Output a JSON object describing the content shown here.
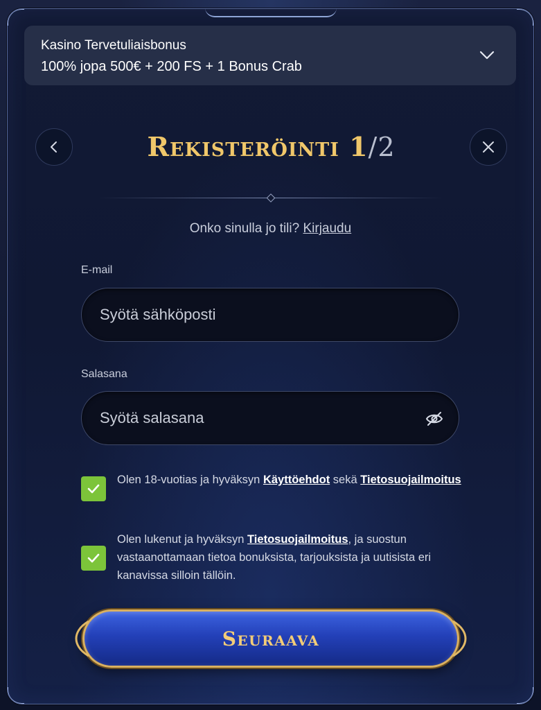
{
  "bonus": {
    "title": "Kasino Tervetuliaisbonus",
    "value": "100% jopa 500€ + 200 FS + 1 Bonus Crab"
  },
  "header": {
    "title": "Rekisteröinti 1",
    "step": "/2"
  },
  "login": {
    "prompt": "Onko sinulla jo tili?",
    "link": "Kirjaudu"
  },
  "form": {
    "email_label": "E-mail",
    "email_placeholder": "Syötä sähköposti",
    "password_label": "Salasana",
    "password_placeholder": "Syötä salasana"
  },
  "consents": [
    {
      "checked": true,
      "text_before": "Olen 18-vuotias ja hyväksyn",
      "link1": "Käyttöehdot",
      "text_middle": "sekä",
      "link2": "Tietosuojailmoitus"
    },
    {
      "checked": true,
      "text_before": "Olen lukenut ja hyväksyn",
      "link1": "Tietosuojailmoitus",
      "text_after": ", ja suostun vastaanottamaan tietoa bonuksista, tarjouksista ja uutisista eri kanavissa silloin tällöin."
    }
  ],
  "next_button": "Seuraava",
  "colors": {
    "gold": "#f0c76a",
    "check_green": "#7cc43a",
    "button_blue": "#2340b8",
    "panel": "#121a35"
  }
}
